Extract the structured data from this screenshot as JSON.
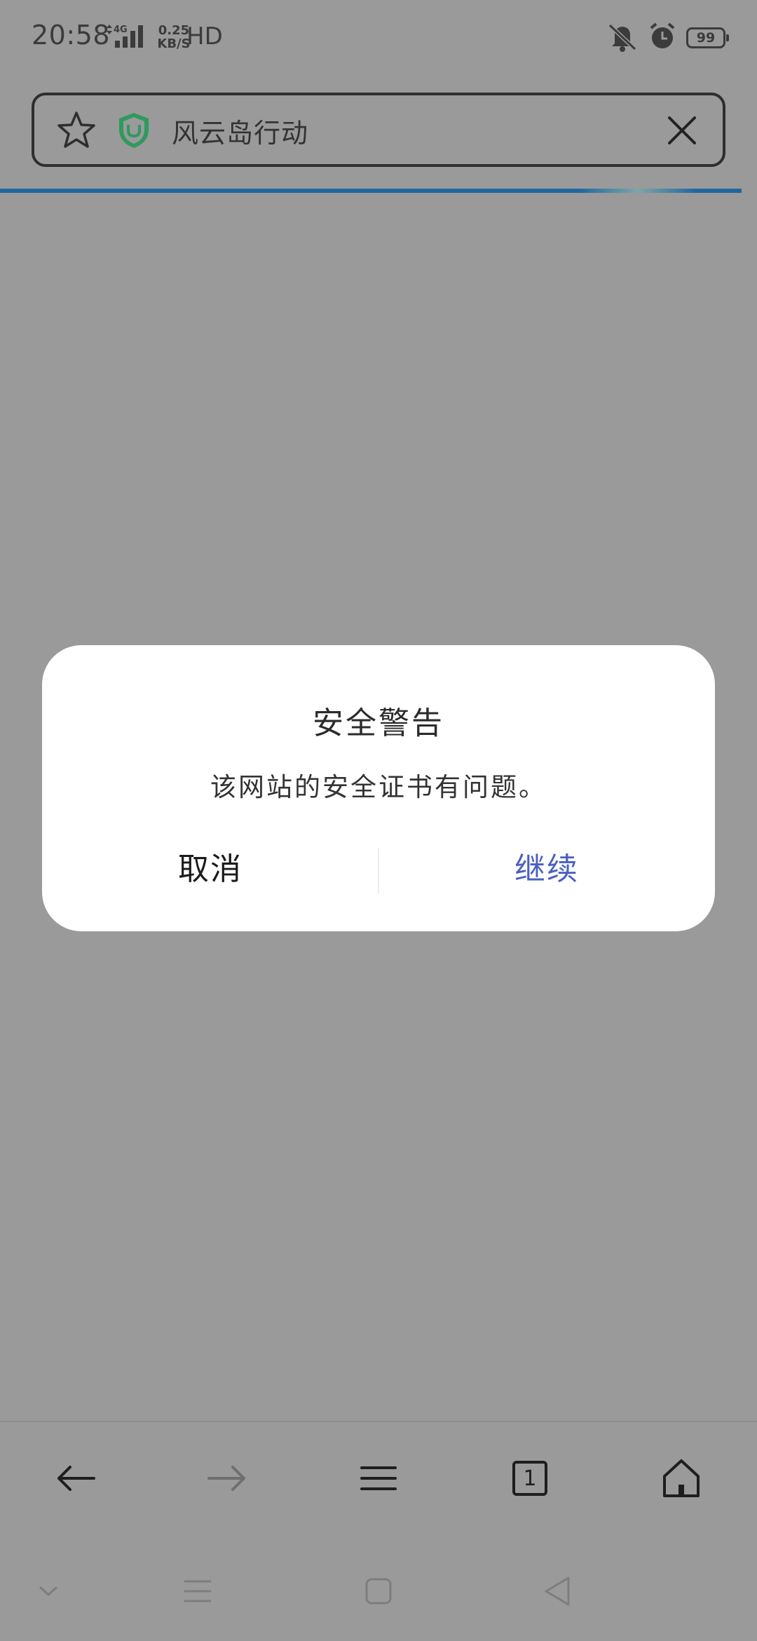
{
  "status_bar": {
    "time": "20:58",
    "network": "4G",
    "speed_value": "0.25",
    "speed_unit": "KB/S",
    "hd": "HD",
    "battery": "99",
    "icons": [
      "signal-icon",
      "mute-icon",
      "alarm-icon",
      "battery-icon"
    ]
  },
  "address_bar": {
    "title": "风云岛行动",
    "icons": [
      "star-icon",
      "shield-icon",
      "close-icon"
    ],
    "shield_color": "#2e9a5e"
  },
  "dialog": {
    "title": "安全警告",
    "message": "该网站的安全证书有问题。",
    "cancel_label": "取消",
    "continue_label": "继续",
    "accent_color": "#4a5fc0"
  },
  "toolbar": {
    "tab_count": "1",
    "icons": [
      "back-icon",
      "forward-icon",
      "menu-icon",
      "tabs-icon",
      "home-icon"
    ]
  },
  "nav_bar": {
    "icons": [
      "collapse-icon",
      "recents-icon",
      "home-square-icon",
      "back-triangle-icon"
    ]
  }
}
